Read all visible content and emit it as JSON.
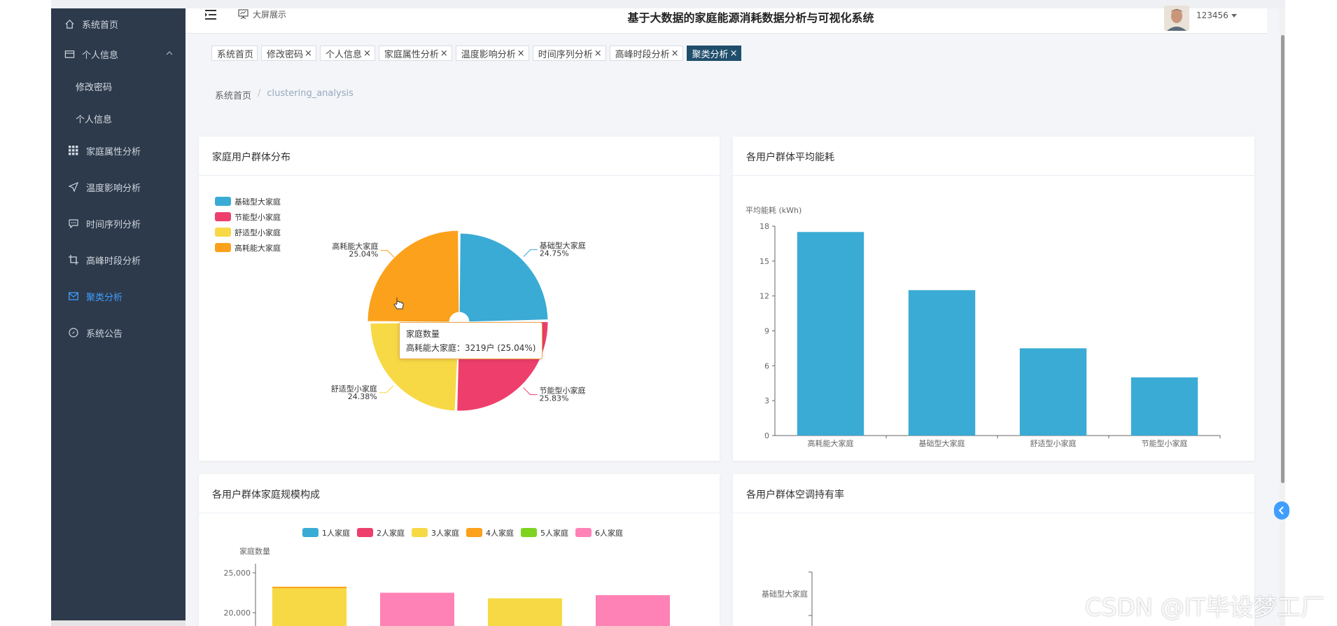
{
  "navbar": {
    "bigscreen_label": "大屏展示",
    "system_title": "基于大数据的家庭能源消耗数据分析与可视化系统",
    "username": "123456"
  },
  "sidebar": {
    "items": [
      {
        "label": "系统首页",
        "icon": "home-icon"
      },
      {
        "label": "个人信息",
        "icon": "id-card-icon"
      },
      {
        "label": "修改密码"
      },
      {
        "label": "个人信息"
      },
      {
        "label": "家庭属性分析",
        "icon": "grid-icon"
      },
      {
        "label": "温度影响分析",
        "icon": "send-icon"
      },
      {
        "label": "时间序列分析",
        "icon": "chat-icon"
      },
      {
        "label": "高峰时段分析",
        "icon": "crop-icon"
      },
      {
        "label": "聚类分析",
        "icon": "mail-icon"
      },
      {
        "label": "系统公告",
        "icon": "compass-icon"
      }
    ],
    "active_color": "#409eff"
  },
  "tags": [
    {
      "label": "系统首页",
      "closable": false
    },
    {
      "label": "修改密码",
      "closable": true
    },
    {
      "label": "个人信息",
      "closable": true
    },
    {
      "label": "家庭属性分析",
      "closable": true
    },
    {
      "label": "温度影响分析",
      "closable": true
    },
    {
      "label": "时间序列分析",
      "closable": true
    },
    {
      "label": "高峰时段分析",
      "closable": true
    },
    {
      "label": "聚类分析",
      "closable": true,
      "active": true
    }
  ],
  "breadcrumb": {
    "home": "系统首页",
    "sep": "/",
    "current": "clustering_analysis"
  },
  "cards": {
    "pie": {
      "title": "家庭用户群体分布"
    },
    "bar": {
      "title": "各用户群体平均能耗"
    },
    "stack": {
      "title": "各用户群体家庭规模构成"
    },
    "ac": {
      "title": "各用户群体空调持有率"
    }
  },
  "tooltip": {
    "title": "家庭数量",
    "body": "高耗能大家庭：3219户 (25.04%)"
  },
  "watermark": "CSDN @IT毕设梦工厂",
  "chart_data": [
    {
      "type": "pie",
      "title": "家庭用户群体分布",
      "legend": [
        "基础型大家庭",
        "节能型小家庭",
        "舒适型小家庭",
        "高耗能大家庭"
      ],
      "slices": [
        {
          "name": "基础型大家庭",
          "percent": 24.75,
          "color": "#3aabd5"
        },
        {
          "name": "节能型小家庭",
          "percent": 25.83,
          "color": "#ee3f6c"
        },
        {
          "name": "舒适型小家庭",
          "percent": 24.38,
          "color": "#f7d945"
        },
        {
          "name": "高耗能大家庭",
          "percent": 25.04,
          "color": "#fba11b",
          "value": 3219
        }
      ],
      "series_name": "家庭数量",
      "unit": "户"
    },
    {
      "type": "bar",
      "title": "各用户群体平均能耗",
      "ylabel": "平均能耗 (kWh)",
      "categories": [
        "高耗能大家庭",
        "基础型大家庭",
        "舒适型小家庭",
        "节能型小家庭"
      ],
      "values": [
        17.5,
        12.5,
        7.5,
        5.0
      ],
      "ylim": [
        0,
        18
      ],
      "yticks": [
        "0",
        "3",
        "6",
        "9",
        "12",
        "15",
        "18"
      ],
      "color": "#3aabd5"
    },
    {
      "type": "bar",
      "title": "各用户群体家庭规模构成",
      "ylabel": "家庭数量",
      "legend": [
        {
          "name": "1人家庭",
          "color": "#3aabd5"
        },
        {
          "name": "2人家庭",
          "color": "#ee3f6c"
        },
        {
          "name": "3人家庭",
          "color": "#f7d945"
        },
        {
          "name": "4人家庭",
          "color": "#fba11b"
        },
        {
          "name": "5人家庭",
          "color": "#7ed321"
        },
        {
          "name": "6人家庭",
          "color": "#ff82b6"
        }
      ],
      "yticks": [
        "25,000",
        "20,000"
      ],
      "ylim_visible": [
        18500,
        25000
      ],
      "visible_bar_tops": [
        {
          "value": 23250,
          "top_color": "#f7d945"
        },
        {
          "value": 22500,
          "top_color": "#ff82b6"
        },
        {
          "value": 21800,
          "top_color": "#f7d945"
        },
        {
          "value": 22200,
          "top_color": "#ff82b6"
        }
      ]
    },
    {
      "type": "bar",
      "title": "各用户群体空调持有率",
      "categories_visible": [
        "基础型大家庭"
      ]
    }
  ]
}
